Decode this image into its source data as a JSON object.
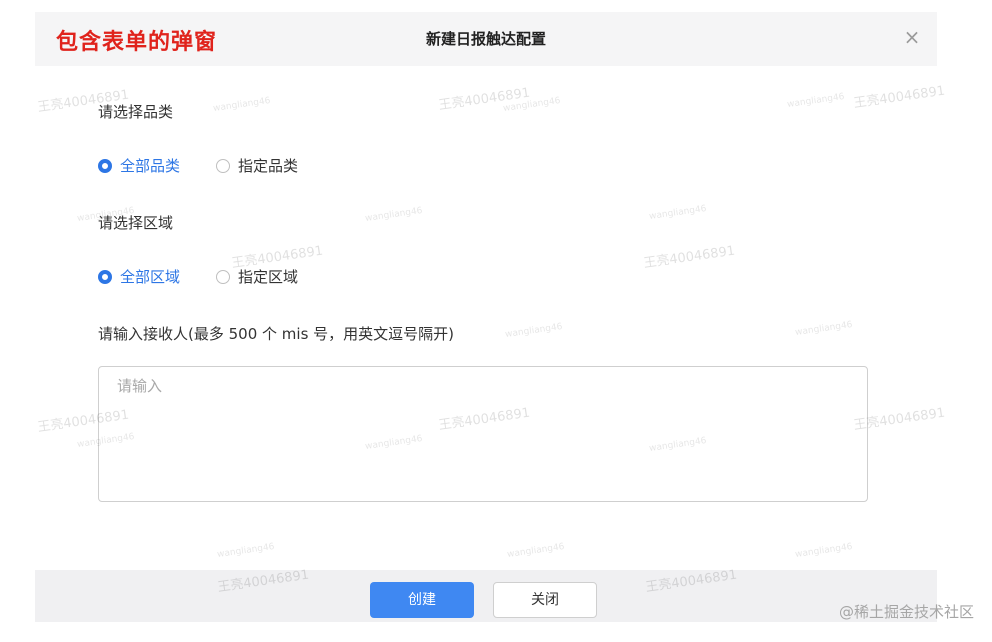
{
  "annotation": "包含表单的弹窗",
  "dialog": {
    "title": "新建日报触达配置",
    "close_symbol": "×"
  },
  "form": {
    "category_label": "请选择品类",
    "category_options": [
      {
        "label": "全部品类",
        "checked": true
      },
      {
        "label": "指定品类",
        "checked": false
      }
    ],
    "region_label": "请选择区域",
    "region_options": [
      {
        "label": "全部区域",
        "checked": true
      },
      {
        "label": "指定区域",
        "checked": false
      }
    ],
    "recipients_label": "请输入接收人(最多 500 个 mis 号，用英文逗号隔开)",
    "recipients_placeholder": "请输入",
    "recipients_value": ""
  },
  "footer": {
    "create_label": "创建",
    "close_label": "关闭"
  },
  "watermark": {
    "text": "王亮40046891",
    "small_text": "wangliang46"
  },
  "credit": "@稀土掘金技术社区",
  "colors": {
    "accent": "#2d76e5",
    "primary_button": "#3f88f2",
    "annotation_red": "#e0231c",
    "header_bg": "#f5f5f6"
  }
}
